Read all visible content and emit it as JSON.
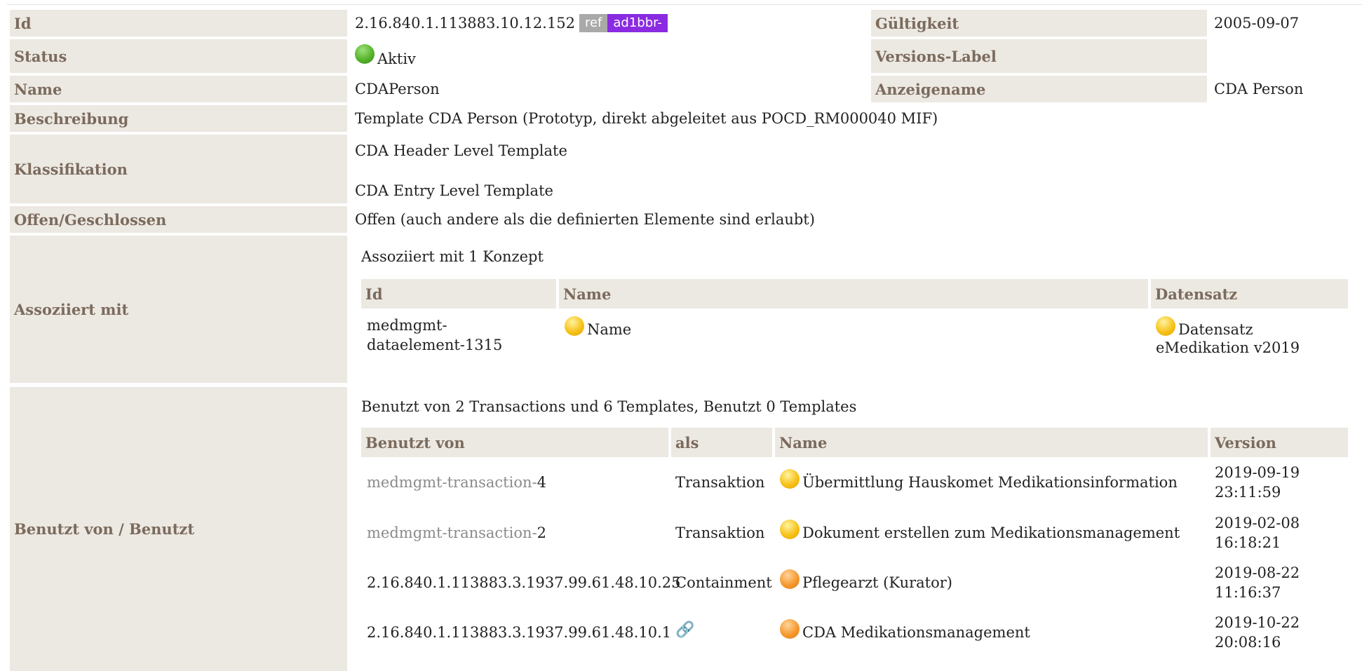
{
  "rows": {
    "id": {
      "label": "Id",
      "value": "2.16.840.1.113883.10.12.152",
      "ref_badge": "ref",
      "prefix_badge": "ad1bbr-"
    },
    "gueltigkeit": {
      "label": "Gültigkeit",
      "value": "2005-09-07"
    },
    "status": {
      "label": "Status",
      "value": "Aktiv",
      "status_color": "#56b32c"
    },
    "versions_label": {
      "label": "Versions-Label",
      "value": ""
    },
    "name": {
      "label": "Name",
      "value": "CDAPerson"
    },
    "anzeigename": {
      "label": "Anzeigename",
      "value": "CDA Person"
    },
    "beschreibung": {
      "label": "Beschreibung",
      "value": "Template CDA Person (Prototyp, direkt abgeleitet aus POCD_RM000040 MIF)"
    },
    "klassifikation": {
      "label": "Klassifikation",
      "values": [
        "CDA Header Level Template",
        "CDA Entry Level Template"
      ]
    },
    "offen": {
      "label": "Offen/Geschlossen",
      "value": "Offen (auch andere als die definierten Elemente sind erlaubt)"
    },
    "assoziiert": {
      "label": "Assoziiert mit"
    },
    "benutzt": {
      "label": "Benutzt von / Benutzt"
    }
  },
  "associations": {
    "summary": "Assoziiert mit 1 Konzept",
    "headers": {
      "id": "Id",
      "name": "Name",
      "datensatz": "Datensatz"
    },
    "rows": [
      {
        "id_line1": "medmgmt-",
        "id_line2": "dataelement-1315",
        "name": "Name",
        "name_icon": "yellow-status-dot",
        "datensatz_line1": "Datensatz",
        "datensatz_line2": "eMedikation v2019",
        "datensatz_icon": "yellow-status-dot"
      }
    ]
  },
  "usage": {
    "summary": "Benutzt von 2 Transactions und 6 Templates, Benutzt 0 Templates",
    "headers": {
      "benutzt_von": "Benutzt von",
      "als": "als",
      "name": "Name",
      "version": "Version"
    },
    "rows": [
      {
        "id_prefix": "medmgmt-transaction-",
        "id_suffix": "4",
        "als": "Transaktion",
        "name": "Übermittlung Hauskomet Medikationsinformation",
        "icon": "yellow-status-dot",
        "date": "2019-09-19",
        "time": "23:11:59"
      },
      {
        "id_prefix": "medmgmt-transaction-",
        "id_suffix": "2",
        "als": "Transaktion",
        "name": "Dokument erstellen zum Medikationsmanagement",
        "icon": "yellow-status-dot",
        "date": "2019-02-08",
        "time": "16:18:21"
      },
      {
        "id_prefix": "",
        "id_suffix": "2.16.840.1.113883.3.1937.99.61.48.10.25",
        "als": "Containment",
        "name": "Pflegearzt (Kurator)",
        "icon": "orange-status-dot",
        "date": "2019-08-22",
        "time": "11:16:37"
      },
      {
        "id_prefix": "",
        "id_suffix": "2.16.840.1.113883.3.1937.99.61.48.10.1",
        "als": "",
        "als_icon": "link-icon",
        "name": "CDA Medikationsmanagement",
        "icon": "orange-status-dot",
        "date": "2019-10-22",
        "time": "20:08:16"
      }
    ]
  },
  "colors": {
    "label_bg": "#ece8e2",
    "label_text": "#7b6b5d",
    "prefix_badge": "#8a2be2",
    "ref_badge": "#a9a9a9"
  }
}
